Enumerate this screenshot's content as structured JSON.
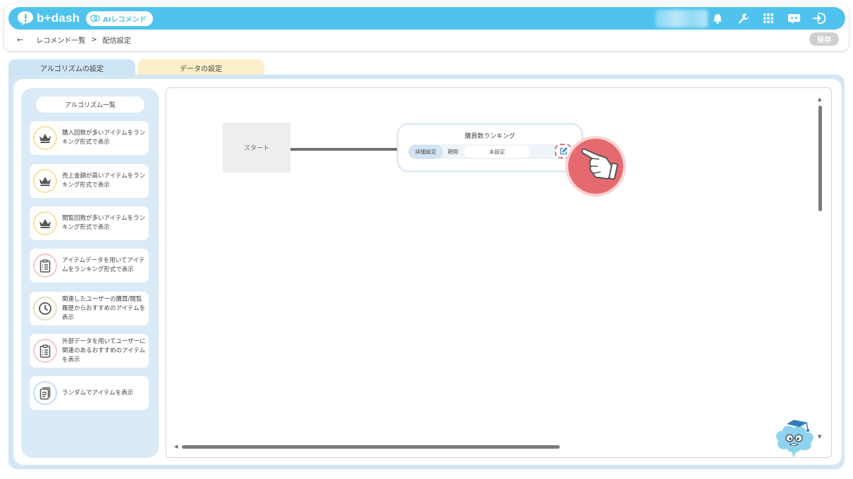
{
  "header": {
    "logo_text": "b+dash",
    "ai_pill_label": "AIレコメンド",
    "icons": [
      "bell-icon",
      "wrench-icon",
      "grid-icon",
      "chat-bot-icon",
      "logout-icon"
    ]
  },
  "breadcrumb": {
    "back": "←",
    "parent": "レコメンド一覧",
    "separator": ">",
    "current": "配信設定"
  },
  "toolbar": {
    "save_label": "保存"
  },
  "tabs": [
    {
      "label": "アルゴリズムの設定",
      "active": true
    },
    {
      "label": "データの設定",
      "active": false
    }
  ],
  "sidebar": {
    "title": "アルゴリズム一覧",
    "items": [
      {
        "label": "購入回数が多いアイテムをランキング形式で表示",
        "icon": "crown-icon"
      },
      {
        "label": "売上金額が高いアイテムをランキング形式で表示",
        "icon": "crown-icon"
      },
      {
        "label": "閲覧回数が多いアイテムをランキング形式で表示",
        "icon": "crown-icon"
      },
      {
        "label": "アイテムデータを用いてアイテムをランキング形式で表示",
        "icon": "clipboard-list-icon"
      },
      {
        "label": "関連したユーザーの購買/閲覧履歴からおすすめのアイテムを表示",
        "icon": "clock-icon"
      },
      {
        "label": "外部データを用いてユーザーに関連のあるおすすめのアイテムを表示",
        "icon": "clipboard-list-icon"
      },
      {
        "label": "ランダムでアイテムを表示",
        "icon": "document-icon"
      }
    ]
  },
  "canvas": {
    "start_label": "スタート",
    "node": {
      "title": "購買数ランキング",
      "detail_label": "詳細設定",
      "period_label": "期間",
      "period_value": "未設定"
    }
  },
  "colors": {
    "topbar": "#4fc3ee",
    "panel": "#d2e6f5",
    "data_tab": "#fcefc9",
    "highlight": "#e56a6f"
  }
}
